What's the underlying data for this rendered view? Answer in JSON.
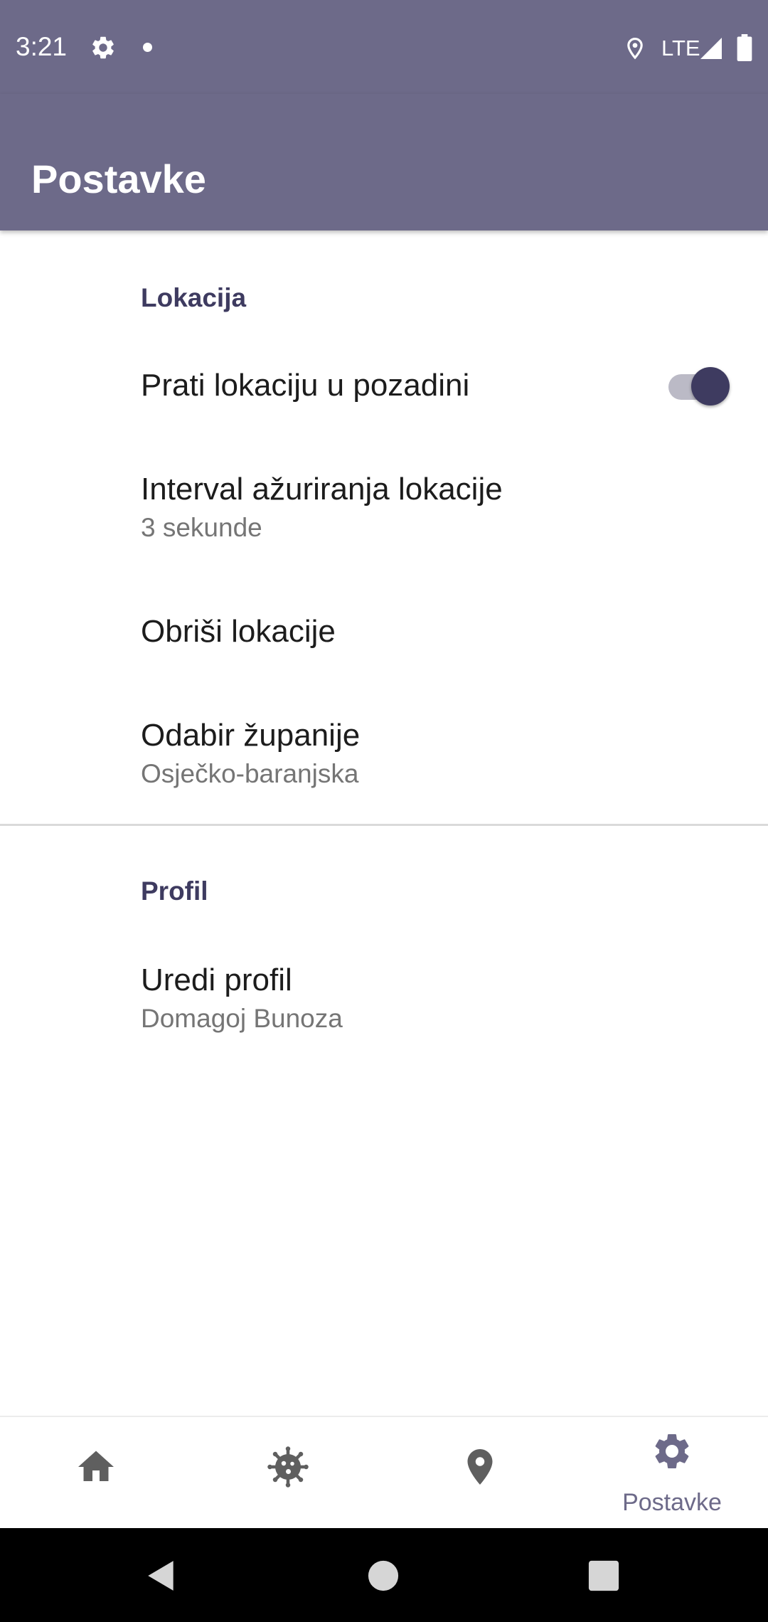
{
  "status_bar": {
    "time": "3:21",
    "network": "LTE",
    "icons": [
      "gear-icon",
      "notification-dot",
      "location-icon",
      "signal-icon",
      "battery-icon"
    ]
  },
  "app_bar": {
    "title": "Postavke"
  },
  "sections": {
    "location": {
      "header": "Lokacija",
      "track_background": {
        "title": "Prati lokaciju u pozadini",
        "enabled": true
      },
      "update_interval": {
        "title": "Interval ažuriranja lokacije",
        "summary": "3 sekunde"
      },
      "delete_locations": {
        "title": "Obriši lokacije"
      },
      "county": {
        "title": "Odabir županije",
        "summary": "Osječko-baranjska"
      }
    },
    "profile": {
      "header": "Profil",
      "edit_profile": {
        "title": "Uredi profil",
        "summary": "Domagoj Bunoza"
      }
    }
  },
  "bottom_nav": {
    "items": [
      {
        "icon": "home-icon"
      },
      {
        "icon": "virus-icon"
      },
      {
        "icon": "map-pin-icon"
      },
      {
        "icon": "gear-icon",
        "label": "Postavke",
        "selected": true
      }
    ]
  },
  "colors": {
    "primary": "#6d6a89",
    "primary_dark": "#3e3b60",
    "nav_icon": "#5f5f5f",
    "summary_text": "#757575"
  }
}
